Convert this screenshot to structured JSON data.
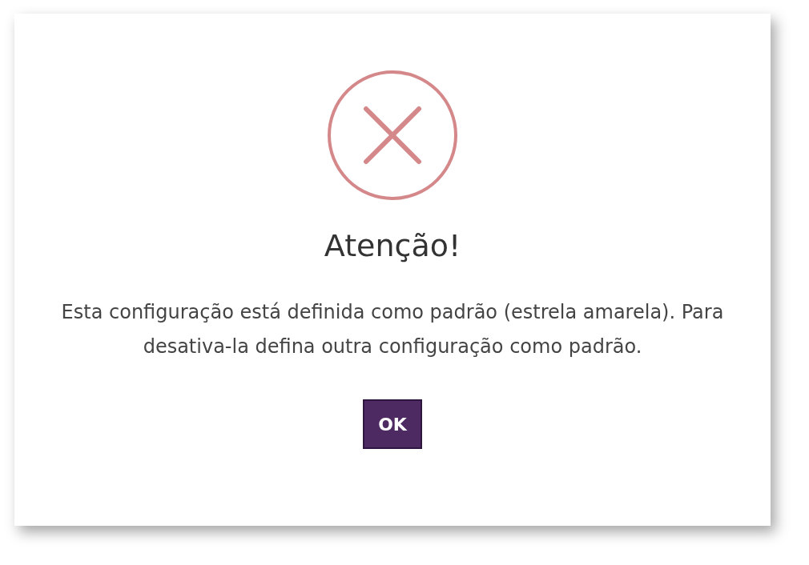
{
  "dialog": {
    "title": "Atenção!",
    "message": "Esta configuração está definida como padrão (estrela amarela). Para desativa-la defina outra configuração como padrão.",
    "buttons": [
      "OK"
    ]
  }
}
